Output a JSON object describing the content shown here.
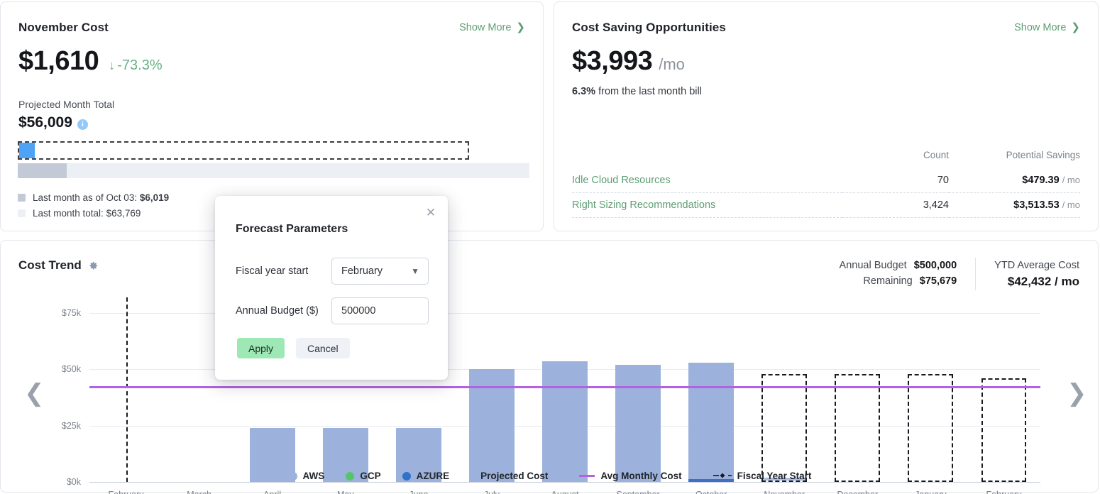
{
  "november_card": {
    "title": "November Cost",
    "show_more": "Show More",
    "amount": "$1,610",
    "delta": "-73.3%",
    "delta_direction": "down",
    "delta_color": "#67b183",
    "projected_label": "Projected Month Total",
    "projected_amount": "$56,009",
    "info_icon": "info-icon",
    "bar_current_pct": 3.5,
    "bar_projected_pct": 85,
    "bar_lastmonth_pct": 9.6,
    "legend": [
      {
        "label_prefix": "Last month as of Oct 03: ",
        "value": "$6,019",
        "color": "#c3c9d6"
      },
      {
        "label_prefix": "Last month total: ",
        "value": "$63,769",
        "color": "#eceff4"
      }
    ]
  },
  "savings_card": {
    "title": "Cost Saving Opportunities",
    "show_more": "Show More",
    "amount": "$3,993",
    "per": "/mo",
    "sub_strong": "6.3%",
    "sub_rest": " from the last month bill",
    "columns": {
      "name": "",
      "count": "Count",
      "savings": "Potential Savings"
    },
    "rows": [
      {
        "name": "Idle Cloud Resources",
        "count": "70",
        "savings": "$479.39",
        "unit": "/ mo"
      },
      {
        "name": "Right Sizing Recommendations",
        "count": "3,424",
        "savings": "$3,513.53",
        "unit": "/ mo"
      }
    ]
  },
  "trend_card": {
    "title": "Cost Trend",
    "gear_icon": "gear-icon",
    "prev_icon": "chevron-left-icon",
    "next_icon": "chevron-right-icon",
    "stats": {
      "annual_budget_label": "Annual Budget",
      "annual_budget_value": "$500,000",
      "remaining_label": "Remaining",
      "remaining_value": "$75,679",
      "ytd_label": "YTD Average Cost",
      "ytd_value": "$42,432 / mo"
    }
  },
  "chart_data": {
    "type": "bar",
    "title": "Cost Trend",
    "xlabel": "",
    "ylabel": "",
    "ylim": [
      0,
      82000
    ],
    "yticks": [
      0,
      25000,
      50000,
      75000
    ],
    "ytick_labels": [
      "$0k",
      "$25k",
      "$50k",
      "$75k"
    ],
    "grid": true,
    "legend_position": "bottom",
    "categories": [
      "February",
      "March",
      "April",
      "May",
      "June",
      "July",
      "August",
      "September",
      "October",
      "November",
      "December",
      "January",
      "February"
    ],
    "series": [
      {
        "name": "AWS",
        "color": "#9cb2dc",
        "values": [
          0,
          0,
          24000,
          24000,
          24000,
          50000,
          53500,
          52000,
          53000,
          1200,
          null,
          null,
          null
        ]
      },
      {
        "name": "GCP",
        "color": "#57c46b",
        "values": [
          0,
          0,
          0,
          0,
          0,
          0,
          0,
          0,
          0,
          0,
          null,
          null,
          null
        ]
      },
      {
        "name": "AZURE",
        "color": "#2f72c9",
        "values": [
          0,
          0,
          0,
          0,
          0,
          0,
          0,
          0,
          1400,
          0,
          null,
          null,
          null
        ]
      }
    ],
    "projected": {
      "name": "Projected Cost",
      "style": "dashed-outline",
      "values": [
        null,
        null,
        null,
        null,
        null,
        null,
        null,
        null,
        null,
        48000,
        48000,
        48000,
        46000
      ]
    },
    "avg_monthly_cost": {
      "name": "Avg Monthly Cost",
      "color": "#b163e0",
      "value": 42432
    },
    "fiscal_year_start": {
      "name": "Fiscal Year Start",
      "month": "February",
      "style": "dashed-vertical"
    },
    "legend_entries": [
      {
        "label": "AWS",
        "marker": "dot",
        "color": "#9cb2dc"
      },
      {
        "label": "GCP",
        "marker": "dot",
        "color": "#57c46b"
      },
      {
        "label": "AZURE",
        "marker": "dot",
        "color": "#2f72c9"
      },
      {
        "label": "Projected Cost",
        "marker": "none",
        "color": "#181a1e"
      },
      {
        "label": "Avg Monthly Cost",
        "marker": "line",
        "color": "#b163e0"
      },
      {
        "label": "Fiscal Year Start",
        "marker": "diamond-dashed",
        "color": "#181a1e"
      }
    ]
  },
  "modal": {
    "title": "Forecast Parameters",
    "close_icon": "close-icon",
    "fiscal_label": "Fiscal year start",
    "fiscal_value": "February",
    "fiscal_chevron": "chevron-down-icon",
    "budget_label": "Annual Budget ($)",
    "budget_value": "500000",
    "apply_label": "Apply",
    "cancel_label": "Cancel"
  }
}
